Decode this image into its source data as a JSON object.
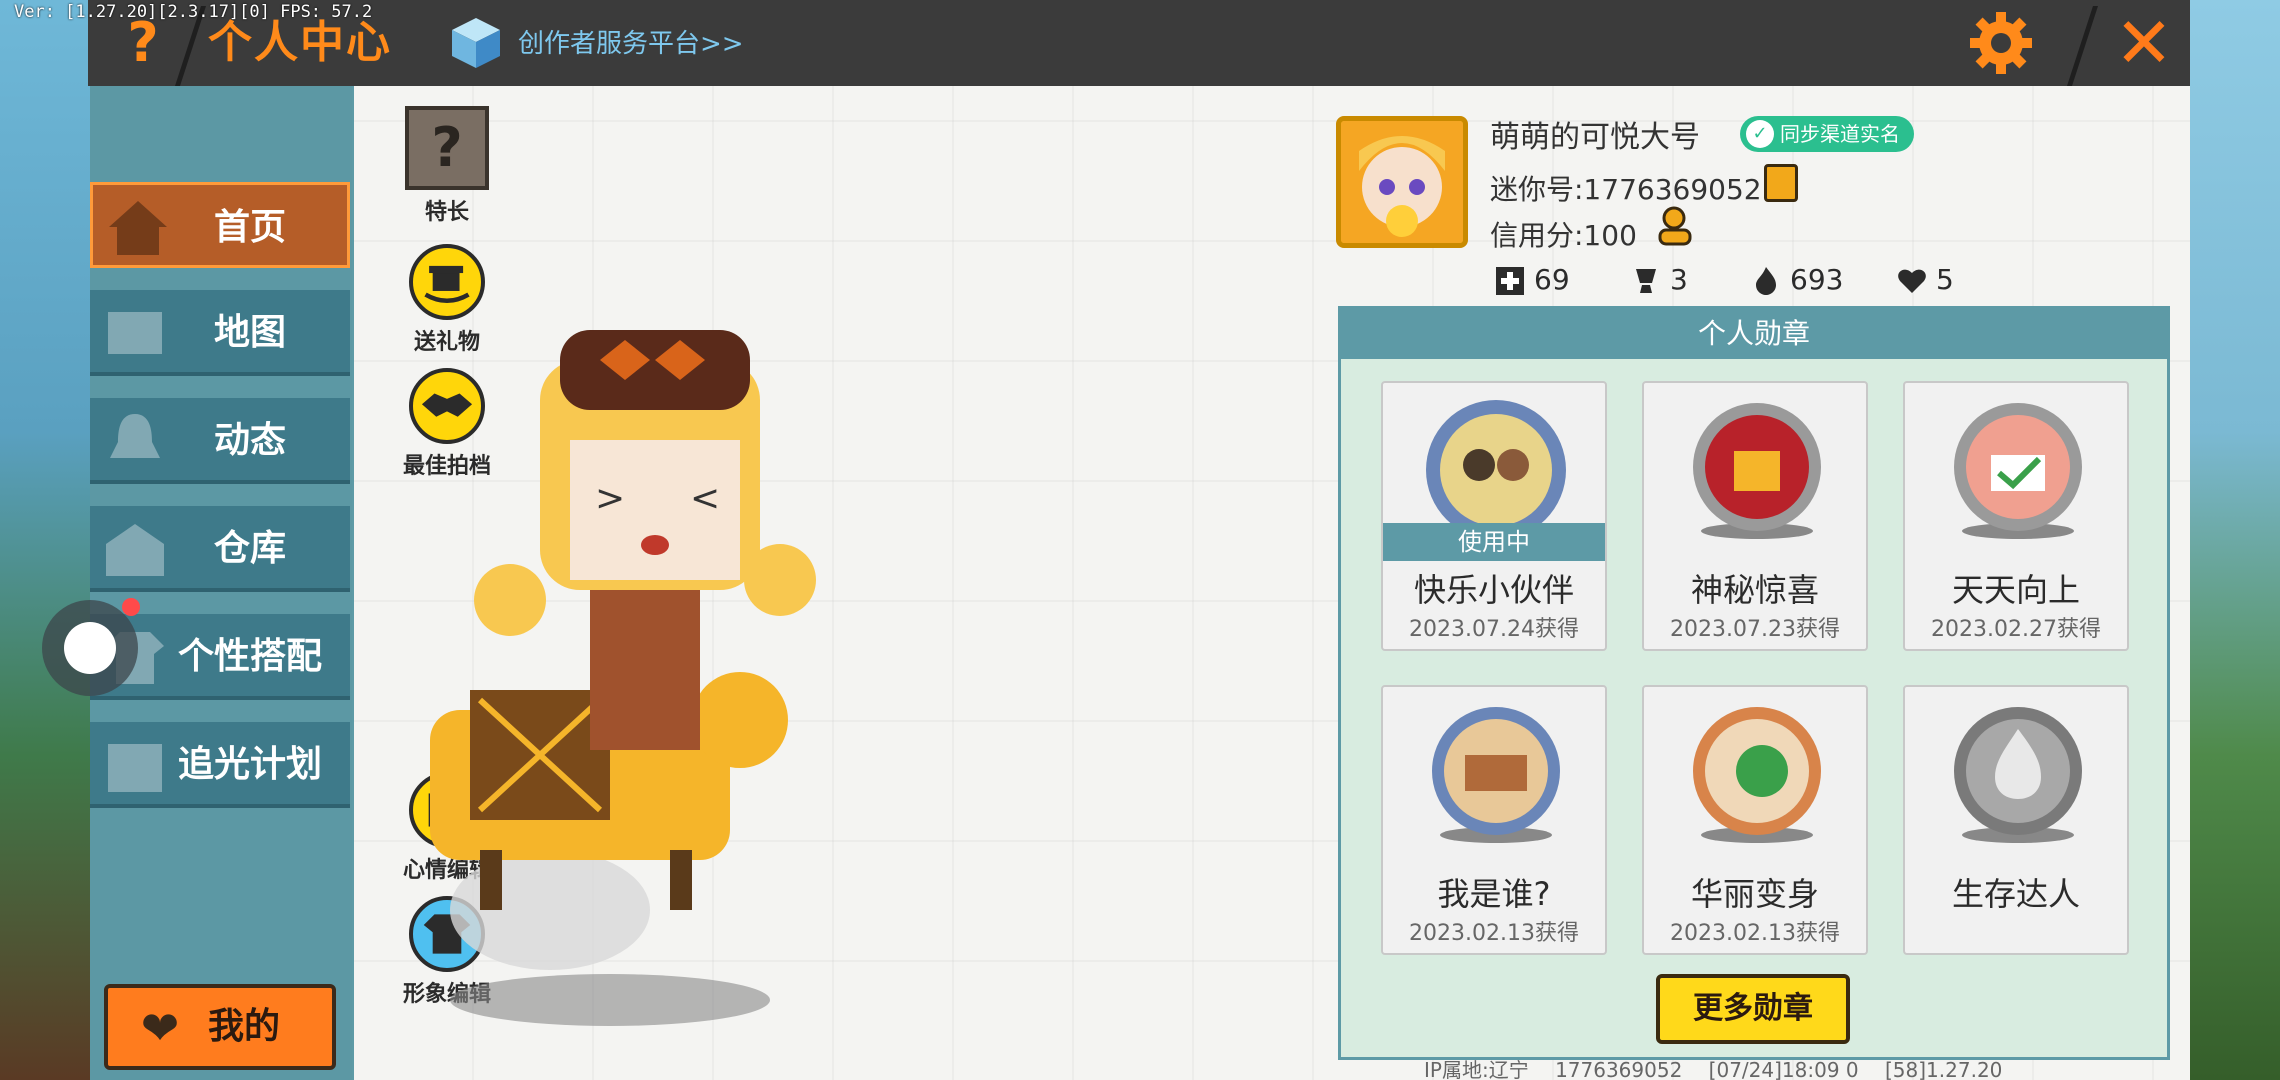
{
  "debug": {
    "fps_text": "Ver: [1.27.20][2.3.17][0] FPS: 57.2"
  },
  "header": {
    "help_icon": "question-icon",
    "title": "个人中心",
    "creator_link": "创作者服务平台>>",
    "settings_icon": "gear-icon",
    "close_icon": "close-icon"
  },
  "sidebar": {
    "items": [
      {
        "label": "首页",
        "icon": "home-icon",
        "active": true
      },
      {
        "label": "地图",
        "icon": "map-icon",
        "active": false
      },
      {
        "label": "动态",
        "icon": "bell-icon",
        "active": false
      },
      {
        "label": "仓库",
        "icon": "warehouse-icon",
        "active": false
      },
      {
        "label": "个性搭配",
        "icon": "outfit-icon",
        "active": false
      },
      {
        "label": "追光计划",
        "icon": "calendar-icon",
        "active": false
      }
    ],
    "mine_label": "我的"
  },
  "actions": {
    "specialty": "特长",
    "gift": "送礼物",
    "partner": "最佳拍档",
    "mood": "心情编辑",
    "appearance": "形象编辑"
  },
  "profile": {
    "nickname": "萌萌的可悦大号",
    "verify_label": "同步渠道实名",
    "mini_id": "迷你号:1776369052",
    "credit": "信用分:100",
    "stats": {
      "followers": "69",
      "likes": "3",
      "heat": "693",
      "hearts": "5"
    }
  },
  "medals": {
    "header": "个人勋章",
    "in_use_label": "使用中",
    "items": [
      {
        "name": "快乐小伙伴",
        "date": "2023.07.24获得",
        "in_use": true
      },
      {
        "name": "神秘惊喜",
        "date": "2023.07.23获得"
      },
      {
        "name": "天天向上",
        "date": "2023.02.27获得"
      },
      {
        "name": "我是谁?",
        "date": "2023.02.13获得"
      },
      {
        "name": "华丽变身",
        "date": "2023.02.13获得"
      },
      {
        "name": "生存达人",
        "date": ""
      }
    ],
    "more_label": "更多勋章"
  },
  "footer": {
    "ip": "IP属地:辽宁",
    "uid": "1776369052",
    "time": "[07/24]18:09 0",
    "version": "[58]1.27.20"
  },
  "colors": {
    "accent_orange": "#ff8a1a",
    "teal": "#5d9aa6",
    "active_tab": "#b55d28",
    "gold": "#ffd60a"
  }
}
